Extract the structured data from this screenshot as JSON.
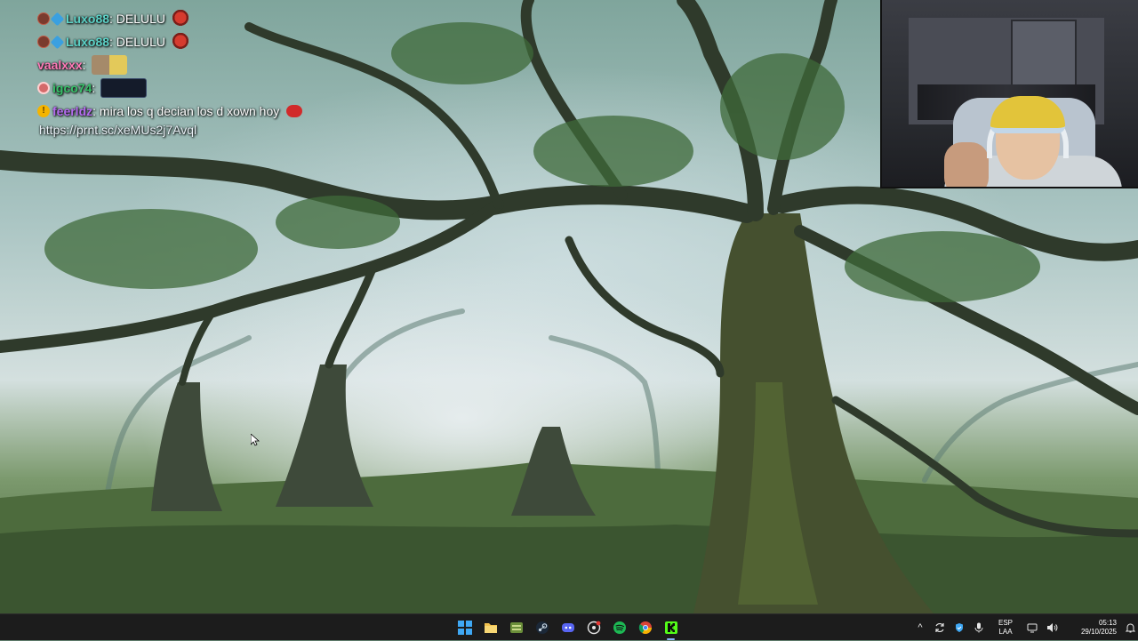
{
  "chat": {
    "messages": [
      {
        "user": "Luxo88",
        "separator": ":",
        "text": "DELULU",
        "user_color": "#5dd3c8",
        "badges": [
          "mod-icon",
          "sub-icon"
        ],
        "emote": "pepe-emote"
      },
      {
        "user": "Luxo88",
        "separator": ":",
        "text": "DELULU",
        "user_color": "#5dd3c8",
        "badges": [
          "mod-icon",
          "sub-icon"
        ],
        "emote": "pepe-emote"
      },
      {
        "user": "vaalxxx",
        "separator": ":",
        "text": "",
        "user_color": "#ff7ab8",
        "badges": [],
        "emote": "pair-emote"
      },
      {
        "user": "igco74",
        "separator": ":",
        "text": "",
        "user_color": "#38c26a",
        "badges": [
          "ring-badge"
        ],
        "emote": "dark-emote"
      },
      {
        "user": "feerldz",
        "separator": ":",
        "text": "mira los q decian los d xown hoy",
        "user_color": "#b56cf0",
        "badges": [
          "gold-badge"
        ],
        "emote": "lips-emote"
      }
    ],
    "link": "https://prnt.sc/xeMUs2j7Avql",
    "gold_badge_glyph": "!"
  },
  "webcam": {
    "description_icon": "webcam-feed"
  },
  "taskbar": {
    "apps": [
      {
        "name": "start",
        "icon": "windows-logo-icon"
      },
      {
        "name": "file-explorer",
        "icon": "folder-icon"
      },
      {
        "name": "app-green",
        "icon": "game-launcher-icon"
      },
      {
        "name": "steam",
        "icon": "steam-icon"
      },
      {
        "name": "discord",
        "icon": "discord-icon"
      },
      {
        "name": "app-circle",
        "icon": "recording-app-icon"
      },
      {
        "name": "spotify",
        "icon": "spotify-icon"
      },
      {
        "name": "chrome",
        "icon": "chrome-icon"
      },
      {
        "name": "kick",
        "icon": "kick-icon"
      }
    ],
    "tray": {
      "chevron": "^",
      "lang_line1": "ESP",
      "lang_line2": "LAA",
      "time": "05:13",
      "date": "29/10/2025"
    }
  },
  "colors": {
    "taskbar_bg": "#1c1c1c",
    "accent": "#3fa8f4",
    "discord": "#5865f2",
    "spotify": "#1db954",
    "kick": "#53fc18"
  }
}
